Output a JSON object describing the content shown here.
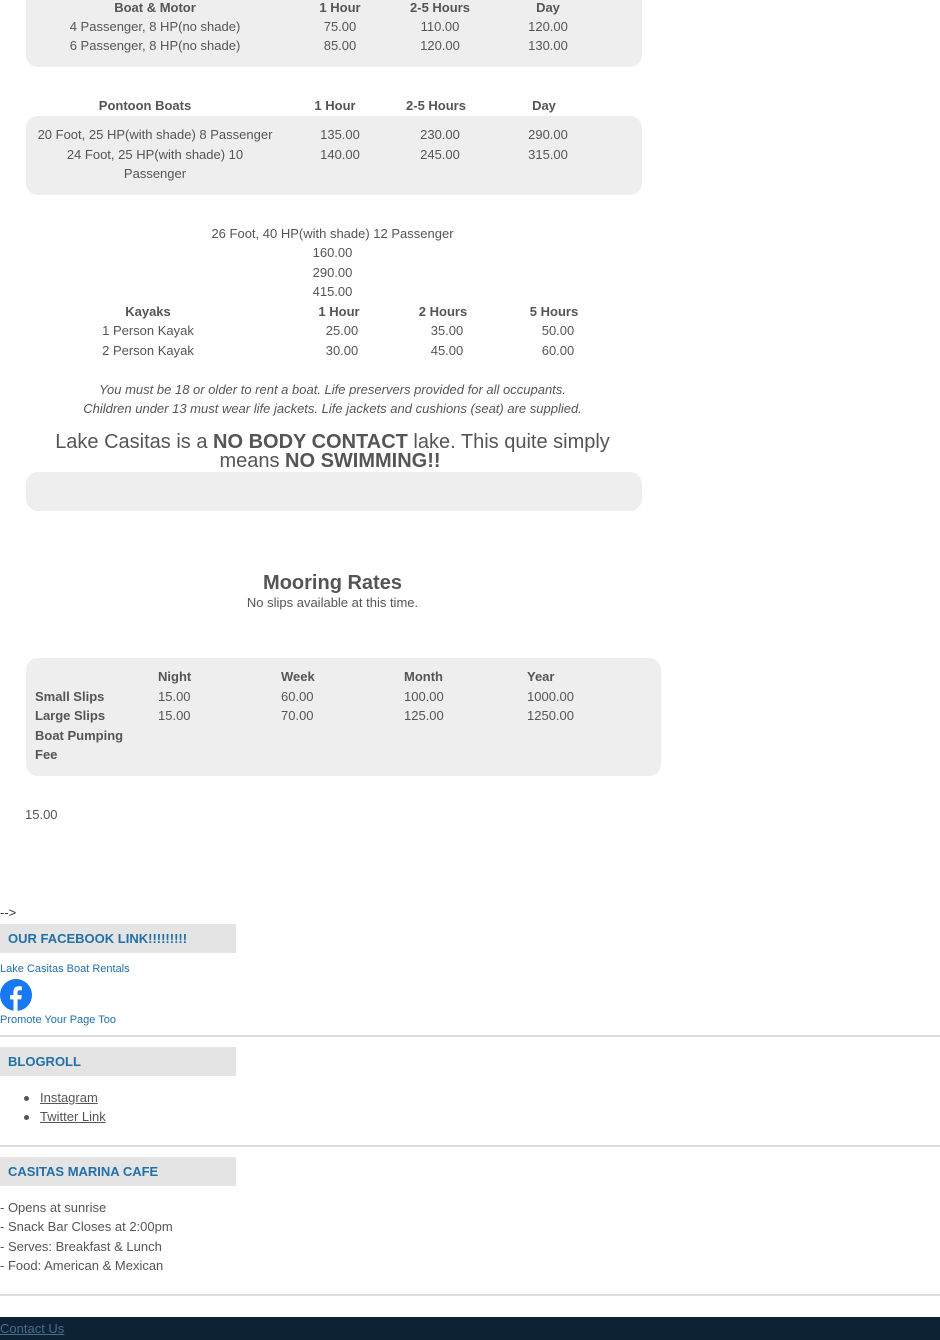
{
  "boat_motor": {
    "headers": [
      "Boat & Motor",
      "1 Hour",
      "2-5 Hours",
      "Day"
    ],
    "rows": [
      [
        "4 Passenger, 8 HP(no shade)",
        "75.00",
        "110.00",
        "120.00"
      ],
      [
        "6 Passenger, 8 HP(no shade)",
        "85.00",
        "120.00",
        "130.00"
      ]
    ]
  },
  "pontoon": {
    "headers": [
      "Pontoon Boats",
      "1 Hour",
      "2-5 Hours",
      "Day"
    ],
    "rows": [
      [
        "20 Foot, 25 HP(with shade) 8 Passenger",
        "135.00",
        "230.00",
        "290.00"
      ],
      [
        "24 Foot, 25 HP(with shade) 10",
        "140.00",
        "245.00",
        "315.00"
      ]
    ],
    "row2_cont": "Passenger"
  },
  "pontoon_large": {
    "label": "26 Foot, 40 HP(with shade) 12 Passenger",
    "prices": [
      "160.00",
      "290.00",
      "415.00"
    ]
  },
  "kayaks": {
    "headers": [
      "Kayaks",
      "1 Hour",
      "2 Hours",
      "5 Hours"
    ],
    "rows": [
      [
        "1 Person Kayak",
        "25.00",
        "35.00",
        "50.00"
      ],
      [
        "2 Person Kayak",
        "30.00",
        "45.00",
        "60.00"
      ]
    ]
  },
  "notice": {
    "line1": "You must be 18 or older to rent a boat.  Life preservers provided for all occupants.",
    "line2": "Children under 13 must wear life jackets.  Life jackets and cushions (seat) are supplied."
  },
  "contact_warning": {
    "part1": "Lake Casitas is a ",
    "bold1": "NO BODY CONTACT",
    "part2": " lake. This quite simply",
    "part3": "means ",
    "bold2": "NO SWIMMING!!"
  },
  "mooring": {
    "title": "Mooring Rates",
    "subtitle": "No slips available at this time.",
    "headers": [
      "",
      "Night",
      "Week",
      "Month",
      "Year"
    ],
    "rows": [
      [
        "Small Slips",
        "15.00",
        "60.00",
        "100.00",
        "1000.00"
      ],
      [
        "Large Slips",
        "15.00",
        "70.00",
        "125.00",
        "1250.00"
      ]
    ],
    "pumping_label_1": "Boat Pumping",
    "pumping_label_2": "Fee",
    "pumping_fee": "15.00"
  },
  "stray_text": "-->",
  "facebook": {
    "heading": "OUR FACEBOOK LINK!!!!!!!!!",
    "page_link": "Lake Casitas Boat Rentals",
    "promote_link": "Promote Your Page Too",
    "icon": "facebook-icon",
    "brand_color": "#1877f2"
  },
  "blogroll": {
    "heading": "BLOGROLL",
    "links": [
      "Instagram",
      "Twitter Link"
    ]
  },
  "cafe": {
    "heading": "CASITAS MARINA CAFE",
    "lines": [
      "- Opens at sunrise",
      "- Snack Bar Closes at 2:00pm",
      "- Serves: Breakfast & Lunch",
      "- Food: American & Mexican"
    ]
  },
  "footer": {
    "contact_link": "Contact Us",
    "bg_color": "#0d2235"
  }
}
